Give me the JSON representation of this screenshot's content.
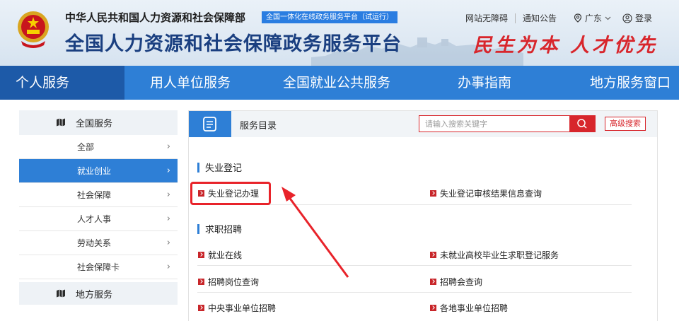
{
  "header": {
    "ministry": "中华人民共和国人力资源和社会保障部",
    "tag": "全国一体化在线政务服务平台（试运行）",
    "platform_title": "全国人力资源和社会保障政务服务平台",
    "slogan": "民生为本 人才优先",
    "links": {
      "accessibility": "网站无障碍",
      "notice": "通知公告",
      "region": "广东",
      "login": "登录"
    }
  },
  "nav": {
    "items": [
      "个人服务",
      "用人单位服务",
      "全国就业公共服务",
      "办事指南",
      "地方服务窗口"
    ]
  },
  "sidebar": {
    "head": "全国服务",
    "items": [
      "全部",
      "就业创业",
      "社会保障",
      "人才人事",
      "劳动关系",
      "社会保障卡"
    ],
    "foot": "地方服务"
  },
  "main": {
    "title": "服务目录",
    "search_placeholder": "请输入搜索关键字",
    "advanced_search": "高级搜索",
    "sections": [
      {
        "title": "失业登记",
        "services": [
          "失业登记办理",
          "失业登记审核结果信息查询"
        ]
      },
      {
        "title": "求职招聘",
        "services": [
          "就业在线",
          "未就业高校毕业生求职登记服务",
          "招聘岗位查询",
          "招聘会查询",
          "中央事业单位招聘",
          "各地事业单位招聘"
        ]
      }
    ]
  },
  "colors": {
    "nav_blue": "#2e7fd6",
    "nav_active": "#1d5aa8",
    "accent_red": "#d7262c",
    "title_blue": "#1a3f80"
  }
}
